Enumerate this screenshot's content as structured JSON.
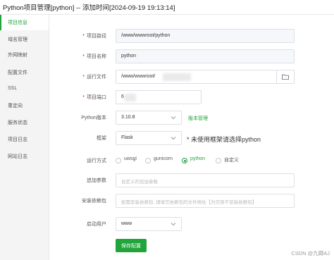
{
  "window": {
    "title": "Python项目管理[python] -- 添加时间[2024-09-19 19:13:14]"
  },
  "sidebar": {
    "items": [
      {
        "label": "项目信息",
        "active": true
      },
      {
        "label": "域名管理"
      },
      {
        "label": "外网映射"
      },
      {
        "label": "配置文件"
      },
      {
        "label": "SSL"
      },
      {
        "label": "重定向"
      },
      {
        "label": "服务状态"
      },
      {
        "label": "项目日志"
      },
      {
        "label": "网站日志"
      }
    ]
  },
  "form": {
    "project_path": {
      "label": "项目路径",
      "value": "/www/wwwroot/python"
    },
    "project_name": {
      "label": "项目名称",
      "value": "python"
    },
    "run_file": {
      "label": "运行文件",
      "value": "/www/wwwroot/"
    },
    "port": {
      "label": "项目端口",
      "value": "6"
    },
    "python_version": {
      "label": "Python版本",
      "value": "3.10.8",
      "link": "版本管理"
    },
    "framework": {
      "label": "框架",
      "value": "Flask",
      "note": "* 未使用框架请选择python"
    },
    "run_mode": {
      "label": "运行方式",
      "options": [
        "uwsgi",
        "gunicorn",
        "python",
        "自定义"
      ],
      "selected": "python"
    },
    "extra_params": {
      "label": "追加参数",
      "placeholder": "自定义的追加参数"
    },
    "dependencies": {
      "label": "安装依赖包",
      "placeholder": "如需安装依赖包, 请填写依赖包的文件地址【为空则不安装依赖包】"
    },
    "run_user": {
      "label": "启动用户",
      "value": "www"
    },
    "save_label": "保存配置"
  },
  "watermark": "CSDN @九卿AJ",
  "colors": {
    "accent": "#20a53a",
    "required": "#ef0808",
    "sidebar_bg": "#f4f4f4"
  }
}
